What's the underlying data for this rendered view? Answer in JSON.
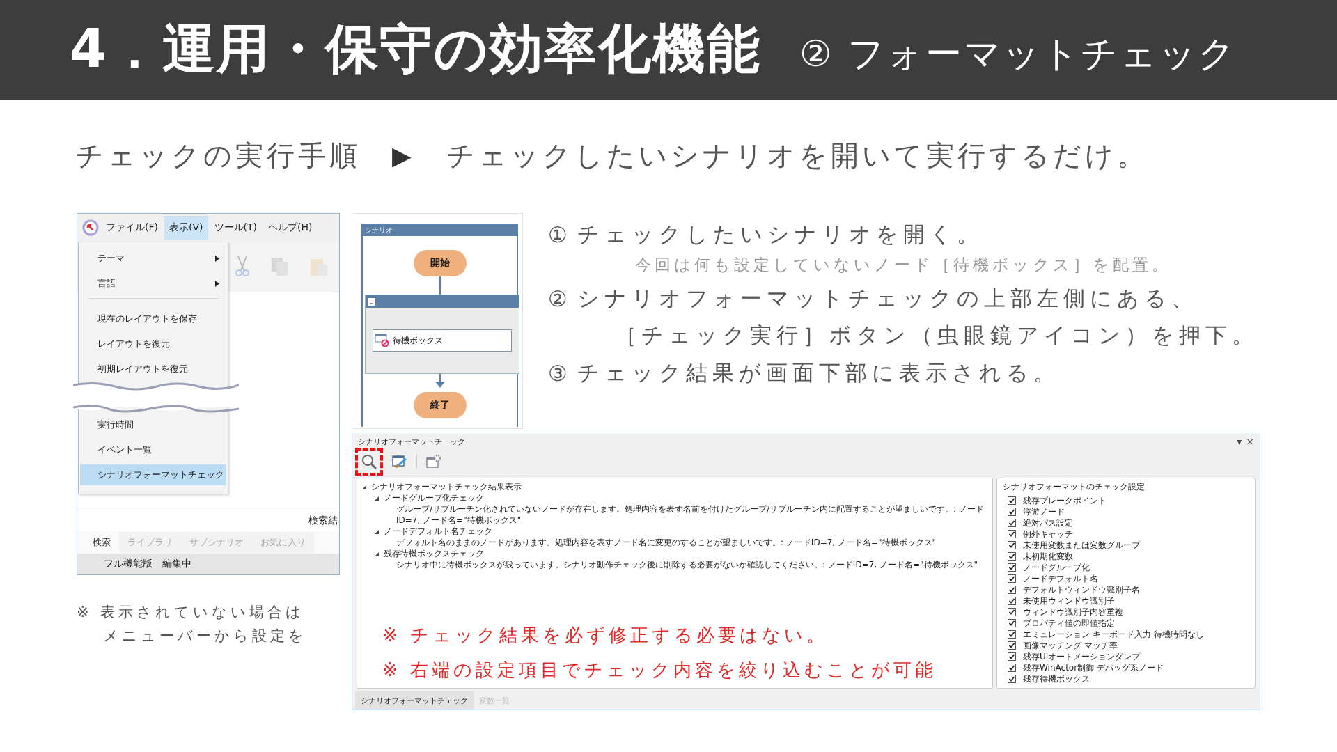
{
  "header": {
    "title": "4．運用・保守の効率化機能",
    "subtitle": "② フォーマットチェック"
  },
  "lead": {
    "label": "チェックの実行手順",
    "arrow": "▶",
    "text": "チェックしたいシナリオを開いて実行するだけ。"
  },
  "app_window": {
    "menu_bar": [
      {
        "label": "ファイル(F)",
        "selected": false
      },
      {
        "label": "表示(V)",
        "selected": true
      },
      {
        "label": "ツール(T)",
        "selected": false
      },
      {
        "label": "ヘルプ(H)",
        "selected": false
      }
    ],
    "menu_items": [
      {
        "kind": "item",
        "label": "テーマ",
        "submenu": true,
        "selected": false
      },
      {
        "kind": "item",
        "label": "言語",
        "submenu": true,
        "selected": false
      },
      {
        "kind": "separator"
      },
      {
        "kind": "item",
        "label": "現在のレイアウトを保存",
        "submenu": false,
        "selected": false
      },
      {
        "kind": "item",
        "label": "レイアウトを復元",
        "submenu": false,
        "selected": false
      },
      {
        "kind": "item",
        "label": "初期レイアウトを復元",
        "submenu": false,
        "selected": false
      },
      {
        "kind": "break"
      },
      {
        "kind": "item",
        "label": "実行時間",
        "submenu": false,
        "selected": false
      },
      {
        "kind": "item",
        "label": "イベント一覧",
        "submenu": false,
        "selected": false
      },
      {
        "kind": "item",
        "label": "シナリオフォーマットチェック",
        "submenu": false,
        "selected": true
      }
    ],
    "results_label": "検索結",
    "tabs": [
      {
        "label": "検索",
        "selected": true
      },
      {
        "label": "ライブラリ",
        "selected": false
      },
      {
        "label": "サブシナリオ",
        "selected": false
      },
      {
        "label": "お気に入り",
        "selected": false
      }
    ],
    "status_bar": [
      "フル機能版",
      "編集中"
    ]
  },
  "left_note": [
    "※ 表示されていない場合は",
    "メニューバーから設定を"
  ],
  "diagram": {
    "title": "シナリオ",
    "start": "開始",
    "node": "待機ボックス",
    "end": "終了"
  },
  "steps": [
    {
      "number": "①",
      "text": "チェックしたいシナリオを開く。",
      "note": "今回は何も設定していないノード［待機ボックス］を配置。"
    },
    {
      "number": "②",
      "text": "シナリオフォーマットチェックの上部左側にある、",
      "note": "［チェック実行］ボタン（虫眼鏡アイコン）を押下。"
    },
    {
      "number": "③",
      "text": "チェック結果が画面下部に表示される。"
    }
  ],
  "check_panel": {
    "title": "シナリオフォーマットチェック",
    "window_controls": [
      "▾",
      "×"
    ],
    "toolbar": [
      {
        "highlighted": true
      },
      {
        "highlighted": false
      },
      {
        "highlighted": false
      }
    ],
    "results": [
      {
        "label": "シナリオフォーマットチェック結果表示",
        "expanded": true,
        "children": [
          {
            "label": "ノードグループ化チェック",
            "expanded": true,
            "children": [
              {
                "label": "グループ/サブルーチン化されていないノードが存在します。処理内容を表す名前を付けたグループ/サブルーチン内に配置することが望ましいです。: ノードID=7, ノード名=\"待機ボックス\""
              }
            ]
          },
          {
            "label": "ノードデフォルト名チェック",
            "expanded": true,
            "children": [
              {
                "label": "デフォルト名のままのノードがあります。処理内容を表すノード名に変更のすることが望ましいです。: ノードID=7, ノード名=\"待機ボックス\""
              }
            ]
          },
          {
            "label": "残存待機ボックスチェック",
            "expanded": true,
            "children": [
              {
                "label": "シナリオ中に待機ボックスが残っています。シナリオ動作チェック後に削除する必要がないか確認してください。: ノードID=7, ノード名=\"待機ボックス\""
              }
            ]
          }
        ]
      }
    ],
    "callouts": [
      "※ チェック結果を必ず修正する必要はない。",
      "※ 右端の設定項目でチェック内容を絞り込むことが可能"
    ],
    "settings": {
      "title": "シナリオフォーマットのチェック設定",
      "items": [
        {
          "label": "残存ブレークポイント",
          "checked": true
        },
        {
          "label": "浮遊ノード",
          "checked": true
        },
        {
          "label": "絶対パス設定",
          "checked": true
        },
        {
          "label": "例外キャッチ",
          "checked": true
        },
        {
          "label": "未使用変数または変数グループ",
          "checked": true
        },
        {
          "label": "未初期化変数",
          "checked": true
        },
        {
          "label": "ノードグループ化",
          "checked": true
        },
        {
          "label": "ノードデフォルト名",
          "checked": true
        },
        {
          "label": "デフォルトウィンドウ識別子名",
          "checked": true
        },
        {
          "label": "未使用ウィンドウ識別子",
          "checked": true
        },
        {
          "label": "ウィンドウ識別子内容重複",
          "checked": true
        },
        {
          "label": "プロパティ値の即値指定",
          "checked": true
        },
        {
          "label": "エミュレーション キーボード入力 待機時間なし",
          "checked": true
        },
        {
          "label": "画像マッチング マッチ率",
          "checked": true
        },
        {
          "label": "残存UIオートメーションダンプ",
          "checked": true
        },
        {
          "label": "残存WinActor制御-デバッグ系ノード",
          "checked": true
        },
        {
          "label": "残存待機ボックス",
          "checked": true
        }
      ]
    },
    "tabs": [
      {
        "label": "シナリオフォーマットチェック",
        "selected": true
      },
      {
        "label": "変数一覧",
        "selected": false
      }
    ]
  }
}
